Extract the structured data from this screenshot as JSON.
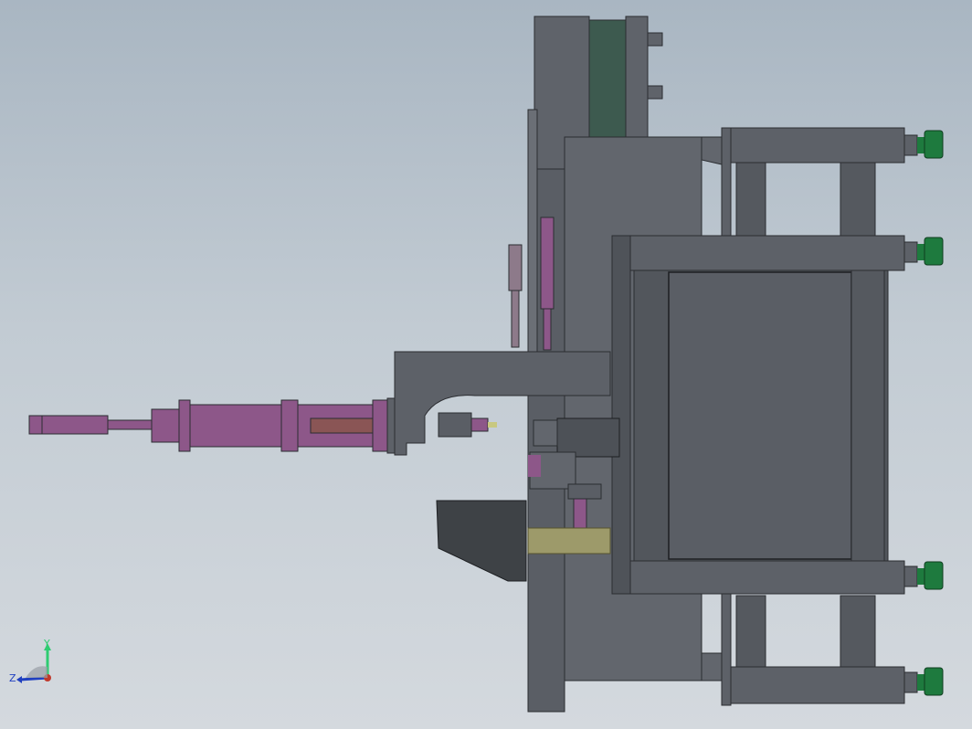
{
  "viewport": {
    "view_orientation": "side",
    "colors": {
      "frame_gray": "#5d6168",
      "frame_dark": "#42464c",
      "cylinder_purple": "#8d5789",
      "plate_green": "#3d5a4f",
      "foot_green": "#1e7a3e",
      "shaft_olive": "#9d9a6a"
    }
  },
  "triad": {
    "y_label": "Y",
    "z_label": "Z",
    "x_axis_color": "#c0392b",
    "y_axis_color": "#2ecc71",
    "z_axis_color": "#2040c0"
  }
}
